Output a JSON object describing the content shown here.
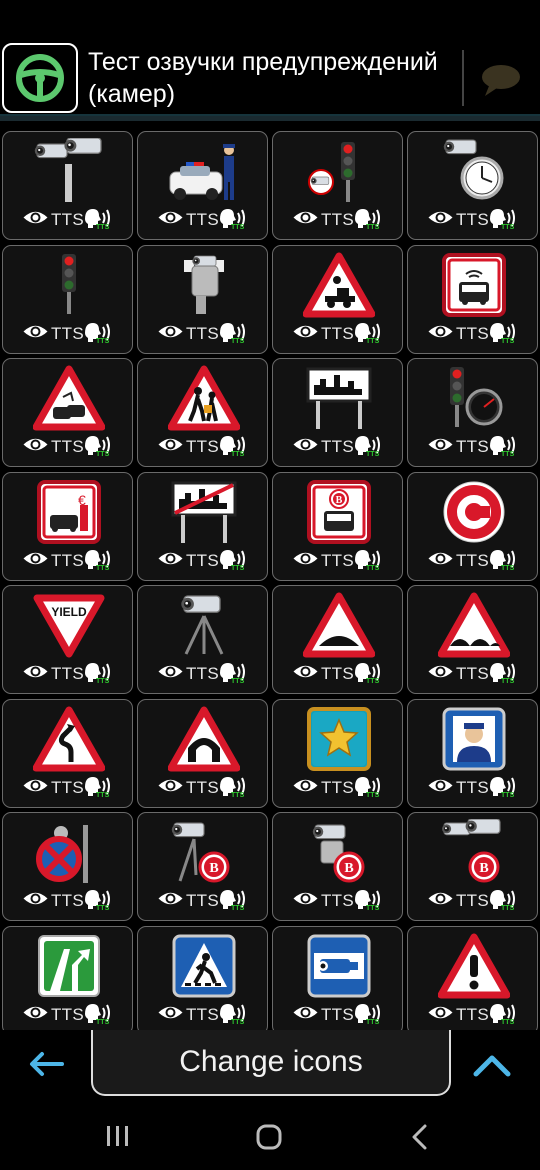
{
  "header": {
    "title": "Тест озвучки предупреждений (камер)",
    "logo_icon": "steering-wheel-icon",
    "chat_icon": "speech-bubble-icon"
  },
  "tile_controls": {
    "tts_label": "TTS",
    "tts_badge": "TTS"
  },
  "tiles": [
    {
      "name": "fixed-speed-camera-icon"
    },
    {
      "name": "police-car-icon"
    },
    {
      "name": "red-light-camera-icon"
    },
    {
      "name": "average-speed-camera-icon"
    },
    {
      "name": "traffic-light-icon"
    },
    {
      "name": "mobile-camera-icon"
    },
    {
      "name": "railway-crossing-icon"
    },
    {
      "name": "bus-lane-camera-icon"
    },
    {
      "name": "accident-zone-icon"
    },
    {
      "name": "school-zone-icon"
    },
    {
      "name": "town-entry-icon"
    },
    {
      "name": "red-light-speed-camera-icon"
    },
    {
      "name": "toll-road-icon"
    },
    {
      "name": "town-exit-icon"
    },
    {
      "name": "bus-lane-icon"
    },
    {
      "name": "congestion-charge-icon"
    },
    {
      "name": "yield-sign-icon"
    },
    {
      "name": "tripod-camera-icon"
    },
    {
      "name": "speed-bump-icon"
    },
    {
      "name": "road-bumps-icon"
    },
    {
      "name": "dangerous-curve-icon"
    },
    {
      "name": "tunnel-icon"
    },
    {
      "name": "favorite-star-icon"
    },
    {
      "name": "police-post-icon"
    },
    {
      "name": "no-stopping-camera-icon"
    },
    {
      "name": "tripod-camera-rear-icon"
    },
    {
      "name": "mobile-camera-rear-icon"
    },
    {
      "name": "fixed-camera-rear-icon"
    },
    {
      "name": "lane-control-icon"
    },
    {
      "name": "pedestrian-crossing-icon"
    },
    {
      "name": "cctv-camera-icon"
    },
    {
      "name": "danger-warning-icon"
    }
  ],
  "bottom": {
    "change_icons_label": "Change icons",
    "back_icon": "arrow-left-icon",
    "up_icon": "chevron-up-icon"
  },
  "colors": {
    "accent_blue": "#4db6e8",
    "sign_red": "#d8182a",
    "tts_green": "#2ec82e"
  }
}
